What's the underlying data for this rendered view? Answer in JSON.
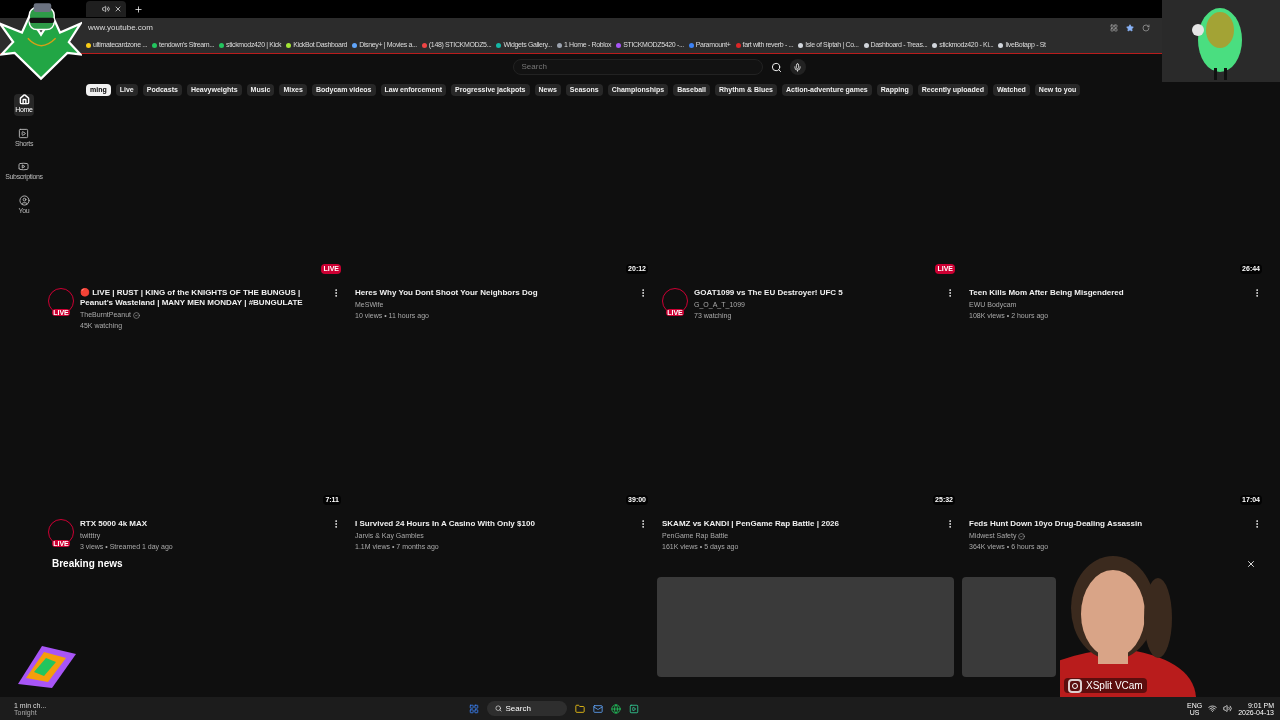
{
  "browser": {
    "address": "www.youtube.com",
    "bookmarks": [
      "ultimatecardzone ...",
      "tendown's Stream...",
      "stickmodz420 | Kick",
      "KickBot Dashboard",
      "Disney+ | Movies a...",
      "(148) STICKMODZ5...",
      "Widgets Gallery...",
      "1 Home - Roblox",
      "STICKMODZ5420 -...",
      "Paramount+",
      "fart with reverb - ...",
      "Isle of Siptah | Co...",
      "Dashboard - Treas...",
      "stickmodz420 - Ki...",
      "liveBotapp - St"
    ]
  },
  "header": {
    "search_placeholder": "Search"
  },
  "sidebar": [
    {
      "label": "Home",
      "selected": true
    },
    {
      "label": "Shorts",
      "selected": false
    },
    {
      "label": "Subscriptions",
      "selected": false
    },
    {
      "label": "You",
      "selected": false
    }
  ],
  "chips": [
    {
      "label": "ming",
      "selected": true
    },
    {
      "label": "Live",
      "selected": false
    },
    {
      "label": "Podcasts",
      "selected": false
    },
    {
      "label": "Heavyweights",
      "selected": false
    },
    {
      "label": "Music",
      "selected": false
    },
    {
      "label": "Mixes",
      "selected": false
    },
    {
      "label": "Bodycam videos",
      "selected": false
    },
    {
      "label": "Law enforcement",
      "selected": false
    },
    {
      "label": "Progressive jackpots",
      "selected": false
    },
    {
      "label": "News",
      "selected": false
    },
    {
      "label": "Seasons",
      "selected": false
    },
    {
      "label": "Championships",
      "selected": false
    },
    {
      "label": "Baseball",
      "selected": false
    },
    {
      "label": "Rhythm & Blues",
      "selected": false
    },
    {
      "label": "Action-adventure games",
      "selected": false
    },
    {
      "label": "Rapping",
      "selected": false
    },
    {
      "label": "Recently uploaded",
      "selected": false
    },
    {
      "label": "Watched",
      "selected": false
    },
    {
      "label": "New to you",
      "selected": false
    }
  ],
  "videos": [
    {
      "kind": "live",
      "badge": "LIVE",
      "avatar_badge": "LIVE",
      "title": "🔴 LIVE | RUST | KING of the KNIGHTS OF THE BUNGUS | Peanut's Wasteland | MANY MEN MONDAY | #BUNGULATE",
      "channel": "TheBurntPeanut",
      "verified": true,
      "meta": "45K watching"
    },
    {
      "kind": "video",
      "badge": "20:12",
      "title": "Heres Why You Dont Shoot Your Neighbors Dog",
      "channel": "MeSWife",
      "verified": false,
      "meta": "10 views • 11 hours ago"
    },
    {
      "kind": "live",
      "badge": "LIVE",
      "avatar_badge": "LIVE",
      "title": "GOAT1099 vs The EU Destroyer! UFC 5",
      "channel": "G_O_A_T_1099",
      "verified": false,
      "meta": "73 watching"
    },
    {
      "kind": "video",
      "badge": "26:44",
      "title": "Teen Kills Mom After Being Misgendered",
      "channel": "EWU Bodycam",
      "verified": false,
      "meta": "108K views • 2 hours ago"
    },
    {
      "kind": "live",
      "badge": "7:11",
      "avatar_badge": "LIVE",
      "title": "RTX 5000 4k MAX",
      "channel": "twitttry",
      "verified": false,
      "meta": "3 views • Streamed 1 day ago"
    },
    {
      "kind": "video",
      "badge": "39:00",
      "title": "I Survived 24 Hours In A Casino With Only $100",
      "channel": "Jarvis & Kay Gambles",
      "verified": false,
      "meta": "1.1M views • 7 months ago"
    },
    {
      "kind": "video",
      "badge": "25:32",
      "title": "SKAMZ vs KANDI | PenGame Rap Battle | 2026",
      "channel": "PenGame Rap Battle",
      "verified": false,
      "meta": "161K views • 5 days ago"
    },
    {
      "kind": "video",
      "badge": "17:04",
      "title": "Feds Hunt Down 10yo Drug-Dealing Assassin",
      "channel": "Midwest Safety",
      "verified": true,
      "meta": "364K views • 6 hours ago"
    }
  ],
  "section": {
    "title": "Breaking news"
  },
  "webcam": {
    "label": "XSplit VCam"
  },
  "weather": {
    "line1": "1 min ch...",
    "line2": "Tonight"
  },
  "taskbar": {
    "search": "Search",
    "lang": "ENG",
    "region": "US",
    "time": "9:01 PM",
    "date": "2026-04-13"
  }
}
